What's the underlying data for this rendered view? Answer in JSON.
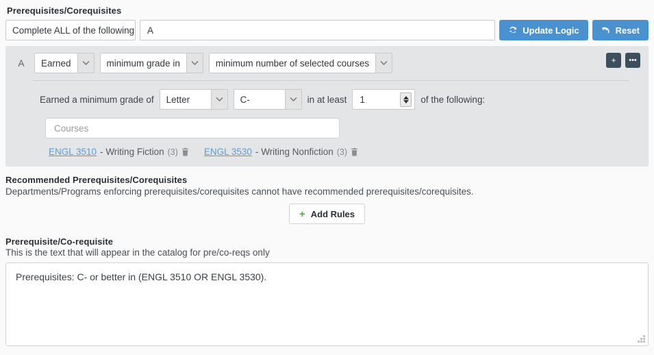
{
  "prereq_section": {
    "title": "Prerequisites/Corequisites",
    "logic_select": {
      "value": "Complete ALL of the following",
      "icon": "chevron-down-icon"
    },
    "logic_text_value": "A",
    "update_logic_button": {
      "label": "Update Logic",
      "icon": "sync-icon"
    },
    "reset_button": {
      "label": "Reset",
      "icon": "undo-icon"
    },
    "accent_blue": "#4a91cf"
  },
  "rule": {
    "letter": "A",
    "selects": [
      {
        "value": "Earned",
        "icon": "chevron-down-icon"
      },
      {
        "value": "minimum grade in",
        "icon": "chevron-down-icon"
      },
      {
        "value": "minimum number of selected courses",
        "icon": "chevron-down-icon"
      }
    ],
    "add_button": {
      "label": "+",
      "icon": "plus-icon"
    },
    "more_button": {
      "label": "•••",
      "icon": "ellipsis-icon"
    },
    "grade_line": {
      "prefix_label": "Earned a minimum grade of",
      "scale_select": {
        "value": "Letter",
        "icon": "chevron-down-icon"
      },
      "grade_select": {
        "value": "C-",
        "icon": "chevron-down-icon"
      },
      "middle_label": "in at least",
      "count_value": "1",
      "suffix_label": "of the following:"
    },
    "courses_input_placeholder": "Courses",
    "courses": [
      {
        "code": "ENGL 3510",
        "separator": "-",
        "title": "Writing Fiction",
        "credits": "(3)",
        "delete_icon": "trash-icon"
      },
      {
        "code": "ENGL 3530",
        "separator": "-",
        "title": "Writing Nonfiction",
        "credits": "(3)",
        "delete_icon": "trash-icon"
      }
    ],
    "panel_bg": "#e4e5e7"
  },
  "recommended_section": {
    "title": "Recommended Prerequisites/Corequisites",
    "description": "Departments/Programs enforcing prerequisites/corequisites cannot have recommended prerequisites/corequisites.",
    "add_rules_button": {
      "label": "Add Rules",
      "icon": "plus-icon",
      "plus": "+",
      "plus_color": "#5aa84f"
    }
  },
  "catalog_text_section": {
    "title": "Prerequisite/Co-requisite",
    "description": "This is the text that will appear in the catalog for pre/co-reqs only",
    "textarea_value": "Prerequisites: C- or better in (ENGL 3510 OR ENGL 3530)."
  }
}
